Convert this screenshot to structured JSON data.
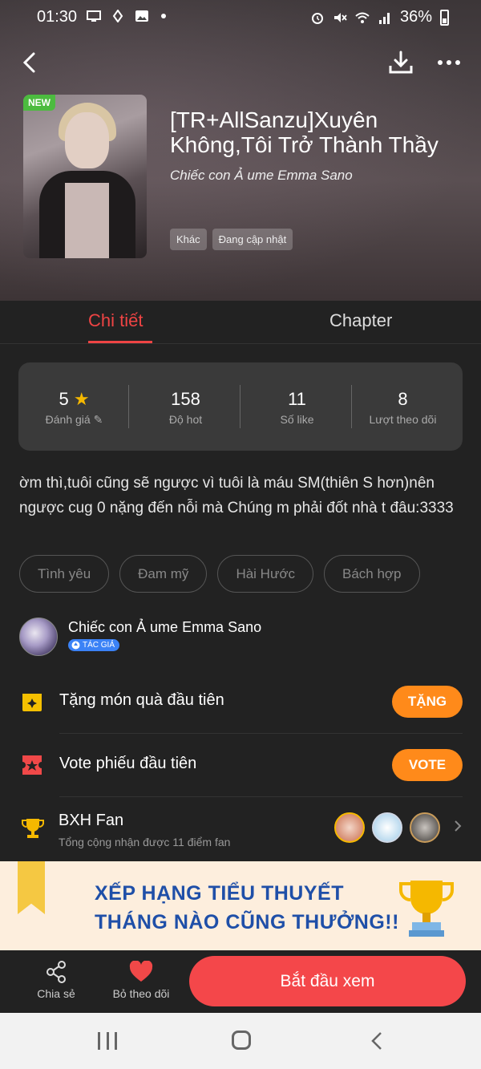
{
  "status_bar": {
    "time": "01:30",
    "battery": "36%"
  },
  "book": {
    "badge": "NEW",
    "title": "[TR+AllSanzu]Xuyên Không,Tôi Trở Thành Thầy",
    "author": "Chiếc con Ả ume Emma Sano",
    "chips": [
      "Khác",
      "Đang cập nhật"
    ]
  },
  "tabs": [
    {
      "label": "Chi tiết",
      "active": true
    },
    {
      "label": "Chapter",
      "active": false
    }
  ],
  "stats": [
    {
      "value": "5",
      "label": "Đánh giá"
    },
    {
      "value": "158",
      "label": "Độ hot"
    },
    {
      "value": "11",
      "label": "Số like"
    },
    {
      "value": "8",
      "label": "Lượt theo dõi"
    }
  ],
  "description": "ờm thì,tuôi cũng sẽ ngược vì tuôi là máu SM(thiên S hơn)nên ngược cug 0 nặng đến nỗi mà Chúng m phải đốt nhà t đâu:3333",
  "tags": [
    "Tình yêu",
    "Đam mỹ",
    "Hài Hước",
    "Bách hợp"
  ],
  "author_block": {
    "name": "Chiếc con Ả ume Emma Sano",
    "role": "TÁC GIẢ"
  },
  "actions": [
    {
      "label": "Tặng món quà đầu tiên",
      "button": "TẶNG",
      "icon": "gift-icon"
    },
    {
      "label": "Vote phiếu đầu tiên",
      "button": "VOTE",
      "icon": "ticket-icon"
    }
  ],
  "fan_ranking": {
    "title": "BXH Fan",
    "subtitle": "Tổng cộng nhận được 11 điểm fan"
  },
  "banner": {
    "line1": "XẾP HẠNG TIỂU THUYẾT",
    "line2": "THÁNG NÀO CŨNG THƯỞNG!!"
  },
  "bottom_bar": {
    "share_label": "Chia sẻ",
    "unfollow_label": "Bỏ theo dõi",
    "start_label": "Bắt đầu xem"
  },
  "colors": {
    "accent_red": "#ef4444",
    "orange": "#ff8a1a",
    "start_button": "#f4474a",
    "banner_text": "#1f4fa8"
  }
}
